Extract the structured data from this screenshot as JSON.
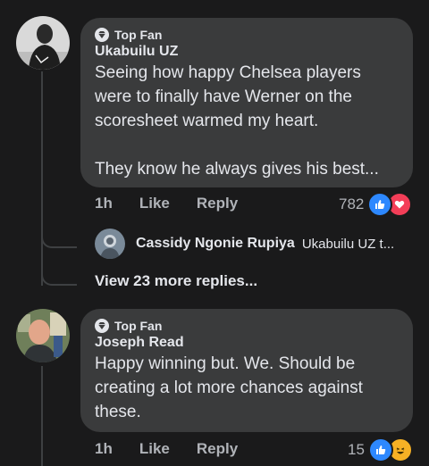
{
  "comments": [
    {
      "badge": "Top Fan",
      "author": "Ukabuilu UZ",
      "text": "Seeing how happy Chelsea players were to finally have Werner on the scoresheet warmed my heart.\n\nThey know he always gives his best...",
      "time": "1h",
      "like_label": "Like",
      "reply_label": "Reply",
      "reaction_count": "782",
      "reactions": [
        "like-icon",
        "love-icon"
      ]
    },
    {
      "badge": "Top Fan",
      "author": "Joseph Read",
      "text": "Happy winning but. We. Should be creating a lot more chances against these.",
      "time": "1h",
      "like_label": "Like",
      "reply_label": "Reply",
      "reaction_count": "15",
      "reactions": [
        "like-icon",
        "haha-icon"
      ]
    }
  ],
  "reply_preview": {
    "name": "Cassidy Ngonie Rupiya",
    "snippet": "Ukabuilu UZ t..."
  },
  "more_replies_label": "View 23 more replies...",
  "colors": {
    "background": "#1a1a1b",
    "bubble": "#3a3b3c",
    "like_blue": "#2d88ff",
    "love_red": "#f33e58",
    "haha_yellow": "#f7b125"
  }
}
